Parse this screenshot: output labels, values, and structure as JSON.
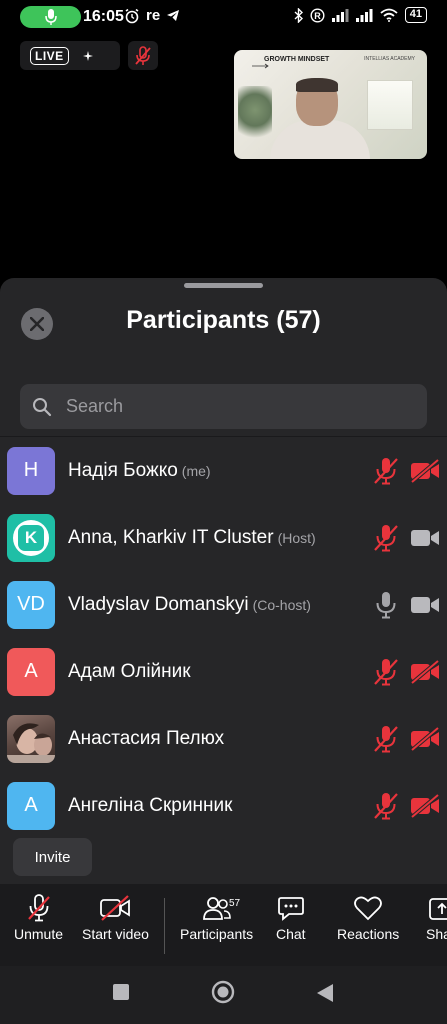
{
  "status_bar": {
    "time": "16:05",
    "carrier_text": "re",
    "battery": "41",
    "icons": [
      "mic-icon",
      "alarm-icon",
      "telegram-icon",
      "bluetooth-icon",
      "registered-icon",
      "signal-icon",
      "signal-icon",
      "wifi-icon",
      "battery-icon"
    ]
  },
  "meeting": {
    "live_label": "LIVE"
  },
  "video_thumbnail": {
    "slide_title": "GROWTH MINDSET",
    "slide_brand": "INTELLIAS ACADEMY"
  },
  "participants_panel": {
    "title": "Participants (57)",
    "search_placeholder": "Search",
    "participants": [
      {
        "name": "Надія Божко",
        "role": "(me)",
        "initials": "Н",
        "avatar_color": "#7b76d6",
        "mic": "muted",
        "camera": "off"
      },
      {
        "name": "Anna, Kharkiv IT Cluster",
        "role": "(Host)",
        "initials": "K",
        "avatar_color": "#1fbfa6",
        "mic": "muted",
        "camera": "on"
      },
      {
        "name": "Vladyslav Domanskyi",
        "role": "(Co-host)",
        "initials": "VD",
        "avatar_color": "#4fb6f0",
        "mic": "on",
        "camera": "on"
      },
      {
        "name": "Адам Олійник",
        "role": "",
        "initials": "А",
        "avatar_color": "#f0595a",
        "mic": "muted",
        "camera": "off"
      },
      {
        "name": "Анастасия Пелюх",
        "role": "",
        "initials": "",
        "avatar_color": "#6a5a54",
        "mic": "muted",
        "camera": "off"
      },
      {
        "name": "Ангеліна Скринник",
        "role": "",
        "initials": "А",
        "avatar_color": "#4fb6f0",
        "mic": "muted",
        "camera": "off"
      }
    ],
    "invite_label": "Invite"
  },
  "toolbar": {
    "unmute_label": "Unmute",
    "start_video_label": "Start video",
    "participants_label": "Participants",
    "participants_count": "57",
    "chat_label": "Chat",
    "reactions_label": "Reactions",
    "share_label": "Sha"
  },
  "colors": {
    "muted_red": "#e8343c",
    "sheet_bg": "#262628",
    "mic_pill": "#3ec45a"
  }
}
